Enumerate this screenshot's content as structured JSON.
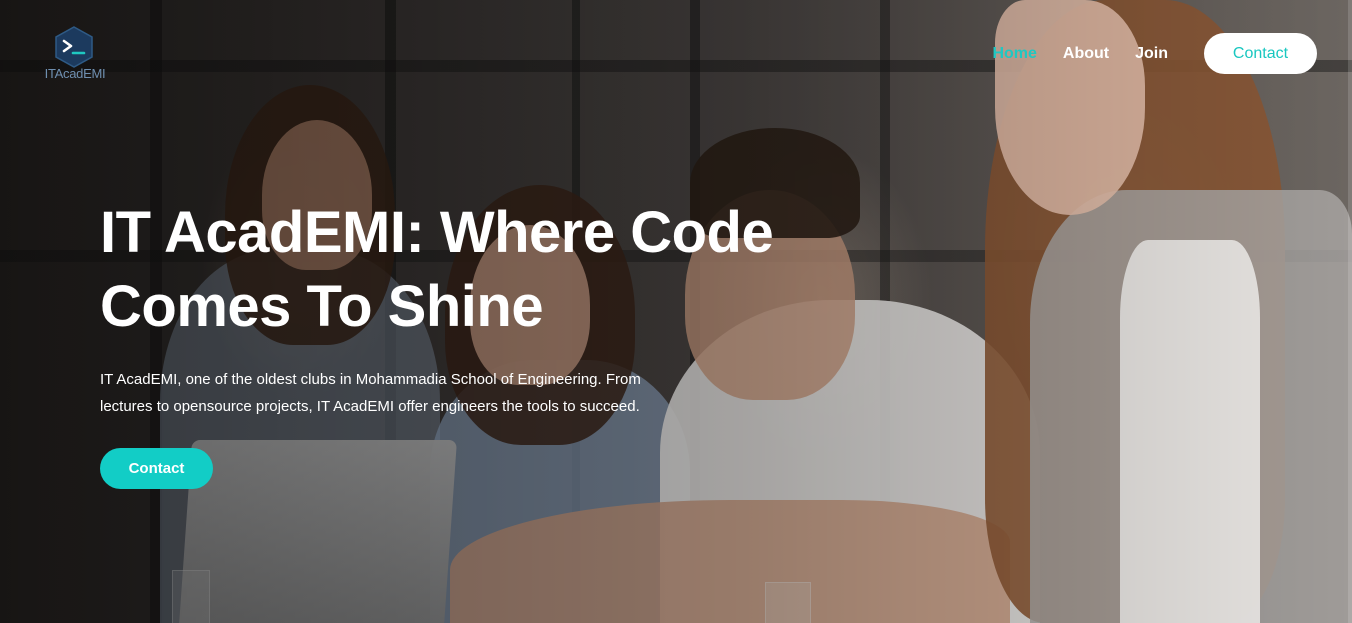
{
  "brand": {
    "logo_icon": "terminal-hex-icon",
    "logo_text": "ITAcadEMI"
  },
  "nav": {
    "items": [
      {
        "label": "Home",
        "active": true
      },
      {
        "label": "About",
        "active": false
      },
      {
        "label": "Join",
        "active": false
      }
    ],
    "contact_label": "Contact"
  },
  "hero": {
    "title_line1": "IT AcadEMI: Where Code",
    "title_line2": "Comes To Shine",
    "description_line1": "IT AcadEMI, one of the oldest clubs in Mohammadia School of Engineering. From",
    "description_line2": "lectures to opensource projects, IT AcadEMI offer engineers the tools to succeed.",
    "cta_label": "Contact"
  },
  "colors": {
    "accent": "#12cdc6",
    "nav_active": "#1fc8c2",
    "text": "#ffffff"
  }
}
